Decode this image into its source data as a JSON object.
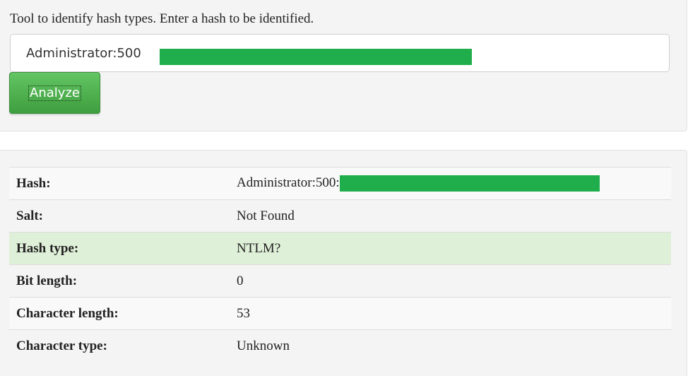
{
  "form": {
    "intro_text": "Tool to identify hash types. Enter a hash to be identified.",
    "hash_input_value": "Administrator:500",
    "analyze_label": "Analyze",
    "redaction_color": "#1fae4b",
    "button_color": "#4cae4c"
  },
  "results": {
    "rows": [
      {
        "key": "Hash:",
        "value": "Administrator:500:",
        "redacted": true
      },
      {
        "key": "Salt:",
        "value": "Not Found"
      },
      {
        "key": "Hash type:",
        "value": "NTLM?",
        "highlight": true
      },
      {
        "key": "Bit length:",
        "value": "0"
      },
      {
        "key": "Character length:",
        "value": "53"
      },
      {
        "key": "Character type:",
        "value": "Unknown"
      }
    ],
    "highlight_color": "#dff0d8"
  }
}
